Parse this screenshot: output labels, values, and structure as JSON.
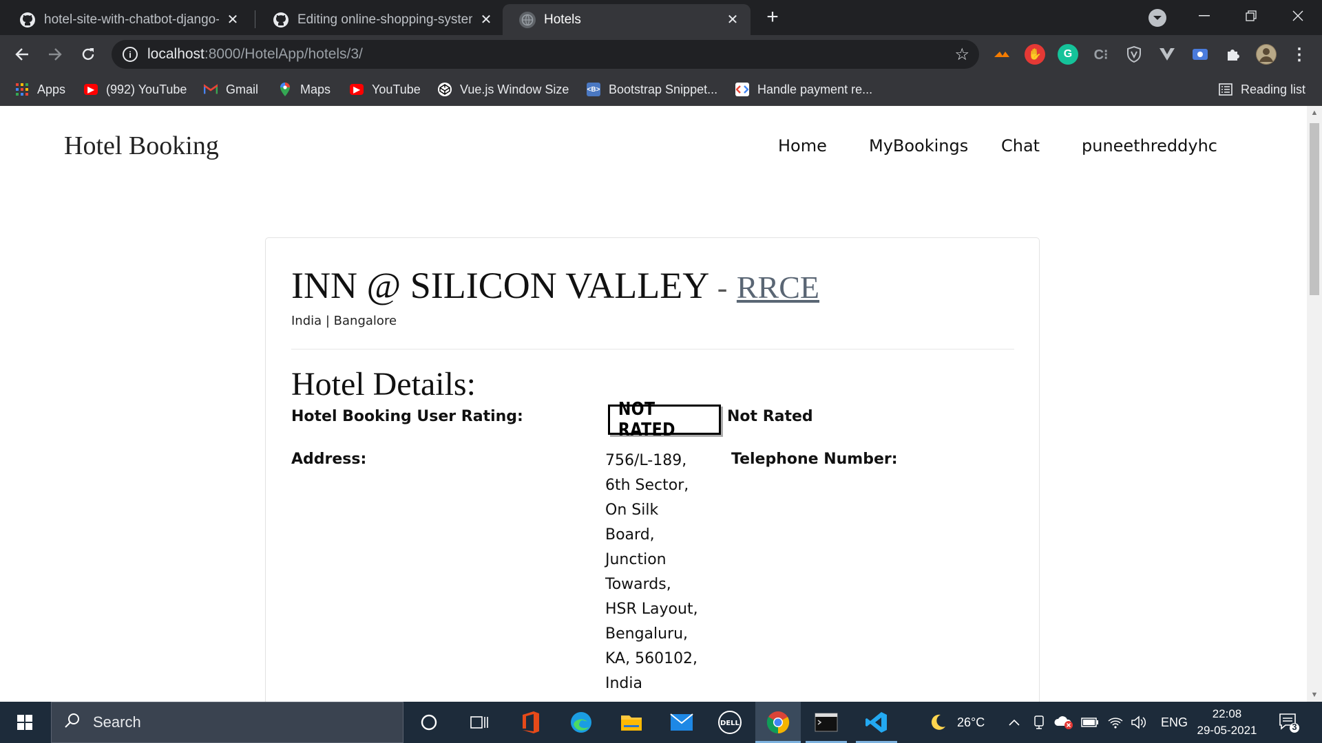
{
  "browser": {
    "tabs": [
      {
        "title": "hotel-site-with-chatbot-django-n",
        "icon": "github-icon",
        "active": false
      },
      {
        "title": "Editing online-shopping-system-",
        "icon": "github-icon",
        "active": false
      },
      {
        "title": "Hotels",
        "icon": "globe-icon",
        "active": true
      }
    ],
    "url_host": "localhost",
    "url_path": ":8000/HotelApp/hotels/3/",
    "bookmarks": [
      {
        "label": "Apps",
        "icon": "apps-grid-icon"
      },
      {
        "label": "(992) YouTube",
        "icon": "youtube-icon"
      },
      {
        "label": "Gmail",
        "icon": "gmail-icon"
      },
      {
        "label": "Maps",
        "icon": "maps-icon"
      },
      {
        "label": "YouTube",
        "icon": "youtube-icon"
      },
      {
        "label": "Vue.js Window Size",
        "icon": "codepen-icon"
      },
      {
        "label": "Bootstrap Snippet...",
        "icon": "bootstrap-icon"
      },
      {
        "label": "Handle payment re...",
        "icon": "code-icon"
      }
    ],
    "reading_list": "Reading list"
  },
  "site": {
    "brand": "Hotel Booking",
    "nav": [
      "Home",
      "MyBookings",
      "Chat",
      "puneethreddyhc"
    ]
  },
  "hotel": {
    "name": "INN @ SILICON VALLEY",
    "separator": "-",
    "code": "RRCE",
    "location": "India | Bangalore",
    "details_heading": "Hotel Details:",
    "rating_label": "Hotel Booking User Rating:",
    "rating_badge": "NOT RATED",
    "rating_text": "Not Rated",
    "address_label": "Address:",
    "address_lines": [
      "756/L-189,",
      "6th Sector,",
      "On Silk",
      "Board,",
      "Junction",
      "Towards,",
      "HSR Layout,",
      "Bengaluru,",
      "KA, 560102,",
      "India"
    ],
    "telephone_label": "Telephone Number:"
  },
  "taskbar": {
    "search_placeholder": "Search",
    "weather": "26°C",
    "language": "ENG",
    "time": "22:08",
    "date": "29-05-2021",
    "notification_count": "3"
  },
  "colors": {
    "chrome_dark": "#202124",
    "chrome_toolbar": "#35363a",
    "taskbar": "#1d2b3a",
    "link_muted": "#5a6674"
  }
}
